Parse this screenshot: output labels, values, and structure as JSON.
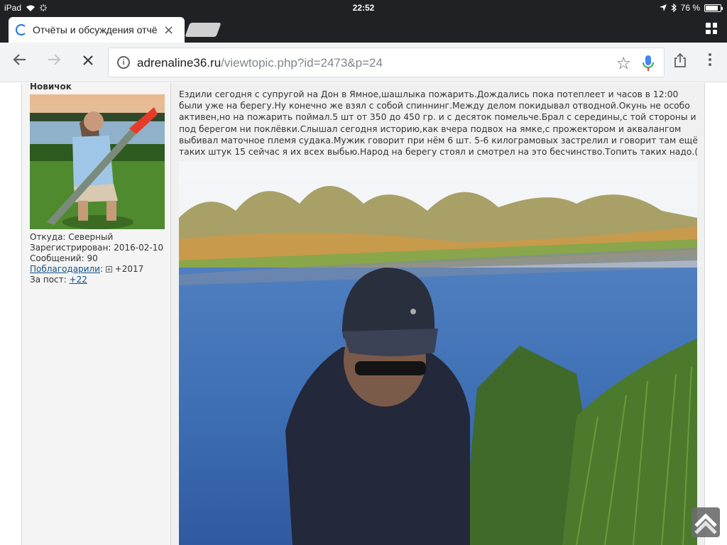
{
  "status_bar": {
    "device": "iPad",
    "time": "22:52",
    "battery": "76 %",
    "battery_level": 0.76
  },
  "tab": {
    "title": "Отчёты и обсуждения отчё",
    "close": "×"
  },
  "omnibox": {
    "host": "adrenaline36.ru",
    "path": "/viewtopic.php?id=2473&p=24"
  },
  "profile": {
    "rank": "Новичок",
    "from": "Откуда: Северный",
    "registered": "Зарегистрирован: 2016-02-10",
    "posts": "Сообщений: 90",
    "thanked_link": "Поблагодарили",
    "thanked_value": "+2017",
    "per_post_label": "За пост:",
    "per_post_value": "+22"
  },
  "post": {
    "text": "Ездили сегодня с супругой на Дон в Ямное,шашлыка пожарить.Дождались пока потеплеет и часов в 12:00 были уже на берегу.Ну конечно же взял с собой спиннинг.Между делом покидывал отводной.Окунь не особо активен,но на пожарить поймал.5 шт от 350 до 450 гр. и с десяток помельче.Брал с середины,с той стороны и под берегом ни поклёвки.Слышал сегодня историю,как вчера подвох на ямке,с прожектором и аквалангом выбивал маточное племя судака.Мужик говорит при нём 6 шт. 5-6 килограмовых застрелил и говорит там ещё таких штук 15 сейчас я их всех выбью.Народ на берегу стоял и смотрел на это бесчинство.Топить таких надо.("
  }
}
